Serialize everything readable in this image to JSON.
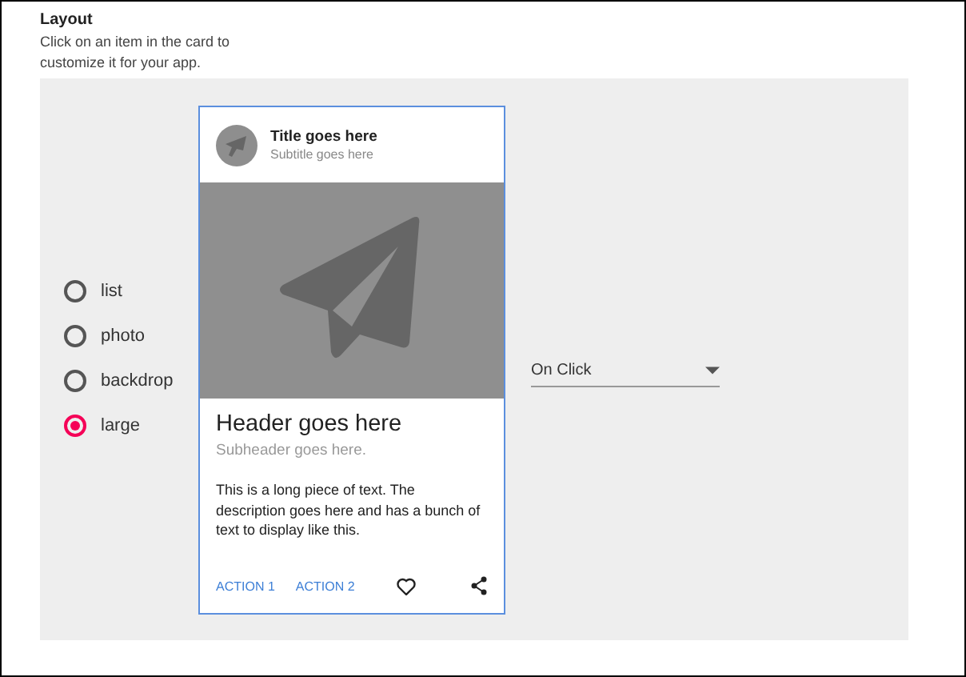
{
  "section": {
    "title": "Layout",
    "description": "Click on an item in the card to customize it for your app."
  },
  "layouts": [
    {
      "label": "list",
      "selected": false
    },
    {
      "label": "photo",
      "selected": false
    },
    {
      "label": "backdrop",
      "selected": false
    },
    {
      "label": "large",
      "selected": true
    }
  ],
  "card": {
    "title": "Title goes here",
    "subtitle": "Subtitle goes here",
    "media": {
      "kind": "placeholder"
    },
    "header": "Header goes here",
    "subheader": "Subheader goes here.",
    "body": "This is a long piece of text. The description goes here and has a bunch of text to display like this.",
    "actions": [
      "ACTION 1",
      "ACTION 2"
    ]
  },
  "trigger": {
    "value": "On Click"
  }
}
